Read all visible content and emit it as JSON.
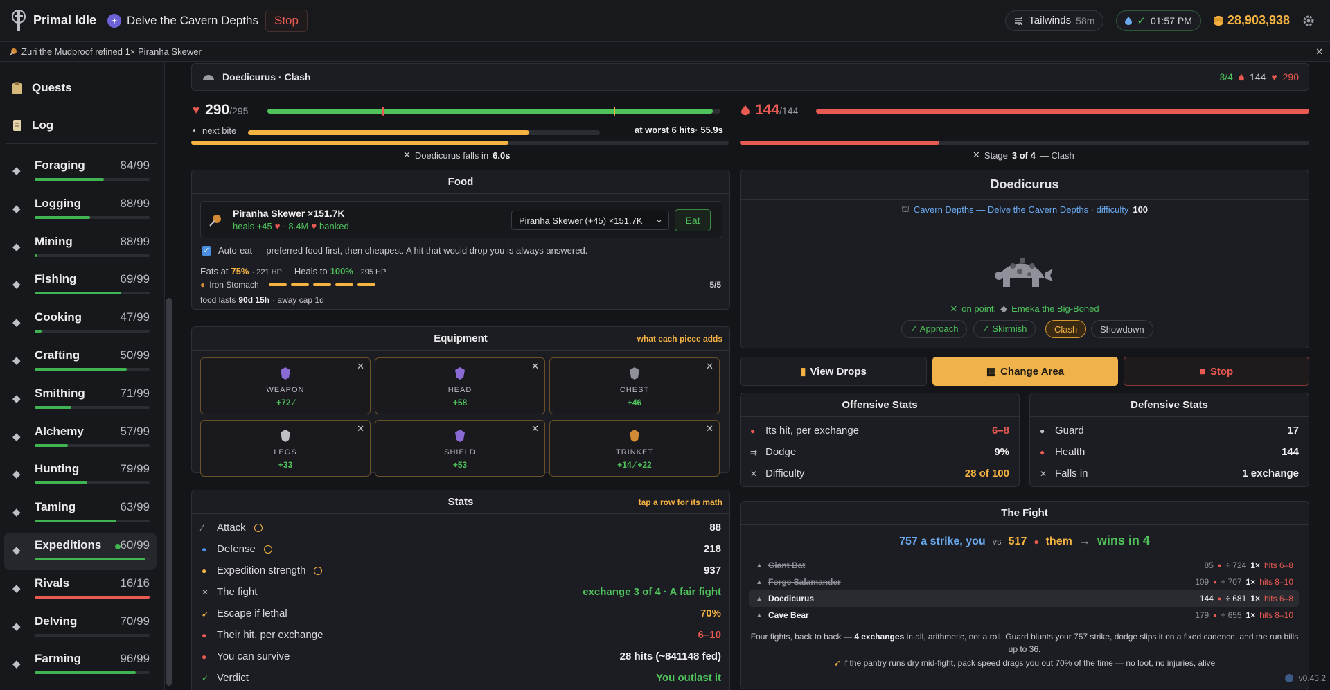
{
  "app": {
    "name": "Primal Idle",
    "activity": "Delve the Cavern Depths",
    "stop": "Stop",
    "buff_name": "Tailwinds",
    "buff_time": "58m",
    "clock": "01:57 PM",
    "gold": "28,903,938"
  },
  "notice": {
    "text": "Zuri the Mudproof refined 1× Piranha Skewer"
  },
  "nav": {
    "quests": "Quests",
    "log": "Log"
  },
  "skills": [
    {
      "name": "Foraging",
      "level": "84/99",
      "progress": 0.6
    },
    {
      "name": "Logging",
      "level": "88/99",
      "progress": 0.48
    },
    {
      "name": "Mining",
      "level": "88/99",
      "progress": 0.02
    },
    {
      "name": "Fishing",
      "level": "69/99",
      "progress": 0.75
    },
    {
      "name": "Cooking",
      "level": "47/99",
      "progress": 0.06
    },
    {
      "name": "Crafting",
      "level": "50/99",
      "progress": 0.8
    },
    {
      "name": "Smithing",
      "level": "71/99",
      "progress": 0.32
    },
    {
      "name": "Alchemy",
      "level": "57/99",
      "progress": 0.29
    },
    {
      "name": "Hunting",
      "level": "79/99",
      "progress": 0.46
    },
    {
      "name": "Taming",
      "level": "63/99",
      "progress": 0.71
    },
    {
      "name": "Expeditions",
      "level": "60/99",
      "progress": 0.96,
      "active": true
    },
    {
      "name": "Rivals",
      "level": "16/16",
      "progress": 1.0,
      "color": "#e85a52"
    },
    {
      "name": "Delving",
      "level": "70/99",
      "progress": 0.0
    },
    {
      "name": "Farming",
      "level": "96/99",
      "progress": 0.88
    }
  ],
  "enemy_bar": {
    "title": "Doedicurus · Clash",
    "stage": "3/4",
    "hp": "144",
    "player_hp": "290"
  },
  "player": {
    "hp": "290",
    "hp_max": "/295",
    "hp_fraction": 0.983,
    "next_bite_label": "next bite",
    "bite_fraction": 0.8,
    "worst": "at worst 6 hits· 55.9s",
    "falls_pre": "Doedicurus falls in",
    "falls_time": "6.0s",
    "under_fraction": 0.59
  },
  "enemy": {
    "hp": "144",
    "hp_max": "/144",
    "hp_fraction": 1.0,
    "under_fraction": 0.35,
    "stage_pre": "Stage",
    "stage_val": "3 of 4",
    "stage_post": "— Clash"
  },
  "food": {
    "title": "Food",
    "item": "Piranha Skewer ×151.7K",
    "heals": "heals +45",
    "banked_pre": "· 8.4M",
    "banked": "banked",
    "select": "Piranha Skewer (+45) ×151.7K",
    "eat": "Eat",
    "autoeat": "Auto-eat — preferred food first, then cheapest. A hit that would drop you is always answered.",
    "eats_at_label": "Eats at",
    "eats_at": "75%",
    "eats_hp": "· 221 HP",
    "heals_to_label": "Heals to",
    "heals_to": "100%",
    "heals_hp": "· 295 HP",
    "perk": "Iron Stomach",
    "perk_count": "5/5",
    "lasts_label": "food lasts",
    "lasts": "90d 15h",
    "away": "· away cap 1d"
  },
  "equipment": {
    "title": "Equipment",
    "hint": "what each piece adds",
    "slots": [
      {
        "label": "WEAPON",
        "value": "+72 ⁄"
      },
      {
        "label": "HEAD",
        "value": "+58"
      },
      {
        "label": "CHEST",
        "value": "+46"
      },
      {
        "label": "LEGS",
        "value": "+33"
      },
      {
        "label": "SHIELD",
        "value": "+53"
      },
      {
        "label": "TRINKET",
        "value": "+14 ⁄ +22"
      }
    ]
  },
  "stats": {
    "title": "Stats",
    "hint": "tap a row for its math",
    "rows": [
      {
        "label": "Attack",
        "value": "88"
      },
      {
        "label": "Defense",
        "value": "218"
      },
      {
        "label": "Expedition strength",
        "value": "937"
      },
      {
        "label": "The fight",
        "value": "exchange 3 of 4 · A fair fight"
      },
      {
        "label": "Escape if lethal",
        "value": "70%"
      },
      {
        "label": "Their hit, per exchange",
        "value": "6–10"
      },
      {
        "label": "You can survive",
        "value": "28 hits (~841148 fed)"
      },
      {
        "label": "Verdict",
        "value": "You outlast it"
      }
    ]
  },
  "monster": {
    "name": "Doedicurus",
    "area": "Cavern Depths — Delve the Cavern Depths · difficulty",
    "difficulty": "100",
    "onpoint_label": "on point:",
    "onpoint": "Emeka the Big-Boned",
    "stages": [
      "✓ Approach",
      "✓ Skirmish",
      "Clash",
      "Showdown"
    ]
  },
  "actions": {
    "drops": "View Drops",
    "change": "Change Area",
    "stop": "Stop"
  },
  "offense": {
    "title": "Offensive Stats",
    "rows": [
      {
        "label": "Its hit, per exchange",
        "value": "6–8"
      },
      {
        "label": "Dodge",
        "value": "9%"
      },
      {
        "label": "Difficulty",
        "value": "28 of 100"
      }
    ]
  },
  "defense": {
    "title": "Defensive Stats",
    "rows": [
      {
        "label": "Guard",
        "value": "17"
      },
      {
        "label": "Health",
        "value": "144"
      },
      {
        "label": "Falls in",
        "value": "1 exchange"
      }
    ]
  },
  "fight": {
    "title": "The Fight",
    "you": "757 a strike, you",
    "vs": "vs",
    "them_val": "517",
    "them": "them",
    "arrow": "→",
    "wins": "wins in 4",
    "rows": [
      {
        "name": "Giant Bat",
        "hp": "85",
        "div": "÷ 724",
        "x": "1×",
        "hits": "hits 6–8",
        "done": true
      },
      {
        "name": "Forge Salamander",
        "hp": "109",
        "div": "÷ 707",
        "x": "1×",
        "hits": "hits 8–10",
        "done": true
      },
      {
        "name": "Doedicurus",
        "hp": "144",
        "div": "÷ 681",
        "x": "1×",
        "hits": "hits 6–8",
        "current": true
      },
      {
        "name": "Cave Bear",
        "hp": "179",
        "div": "÷ 655",
        "x": "1×",
        "hits": "hits 8–10"
      }
    ],
    "desc_pre": "Four fights, back to back —",
    "desc_bold": "4 exchanges",
    "desc_post": "in all, arithmetic, not a roll. Guard blunts your 757 strike, dodge slips it on a fixed cadence, and the run bills up to 36.",
    "pantry": "if the pantry runs dry mid-fight, pack speed drags you out 70% of the time — no loot, no injuries, alive"
  },
  "version": "v0.43.2",
  "colors": {
    "accent": "#f5b342",
    "good": "#4fc25c",
    "bad": "#e85a52",
    "link": "#6aa9ef"
  }
}
